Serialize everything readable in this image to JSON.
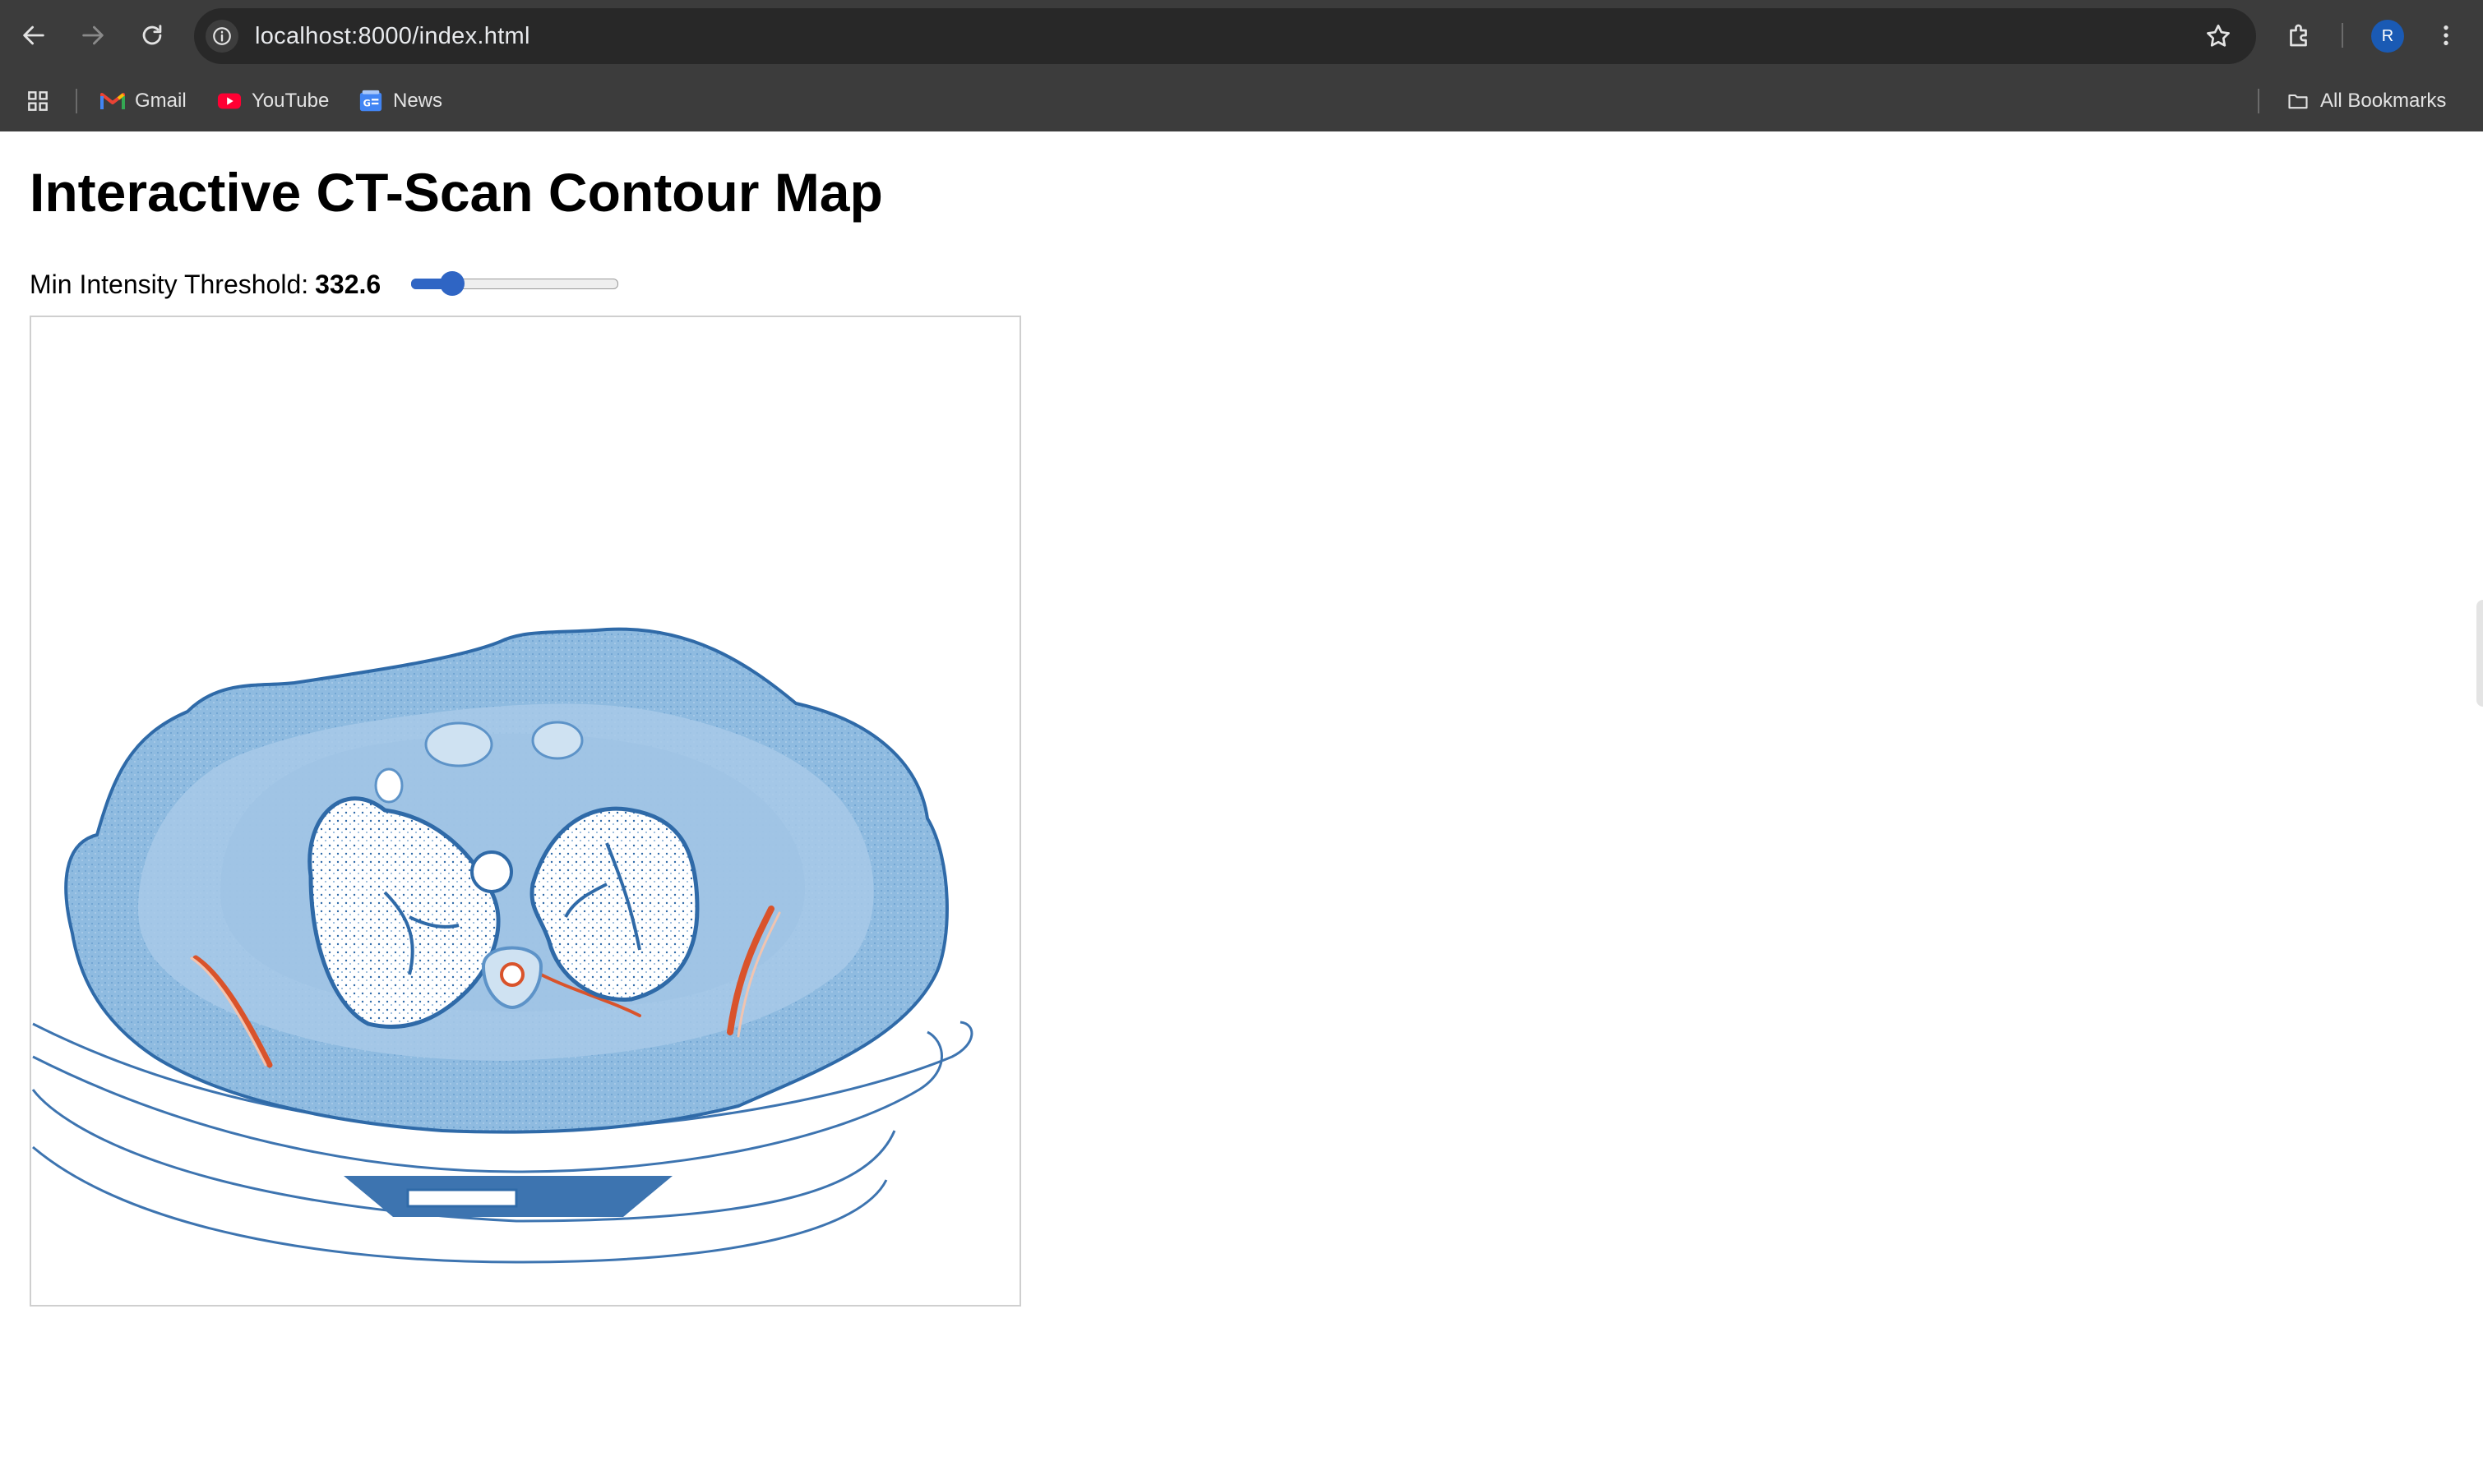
{
  "browser": {
    "url": "localhost:8000/index.html",
    "profile_initial": "R",
    "bookmarks": [
      {
        "label": "Gmail",
        "icon": "gmail-icon"
      },
      {
        "label": "YouTube",
        "icon": "youtube-icon"
      },
      {
        "label": "News",
        "icon": "google-news-icon"
      }
    ],
    "all_bookmarks_label": "All Bookmarks",
    "icons": {
      "back": "arrow-left-icon",
      "forward": "arrow-right-icon",
      "reload": "reload-icon",
      "site_info": "info-icon",
      "bookmark_star": "star-icon",
      "extensions": "puzzle-icon",
      "menu": "kebab-menu-icon",
      "apps": "apps-grid-icon",
      "folder": "folder-icon"
    }
  },
  "page": {
    "title": "Interactive CT-Scan Contour Map",
    "threshold_label": "Min Intensity Threshold:",
    "threshold_value": "332.6",
    "slider_level": 0.16
  },
  "colors": {
    "chrome_bg": "#3c3c3c",
    "omnibox_bg": "#282828",
    "accent": "#2f65c4",
    "contour_dark": "#2f6aa8",
    "contour_mid": "#7fb0d9",
    "contour_light": "#b9d4ea",
    "bone_hot": "#d9532b"
  }
}
